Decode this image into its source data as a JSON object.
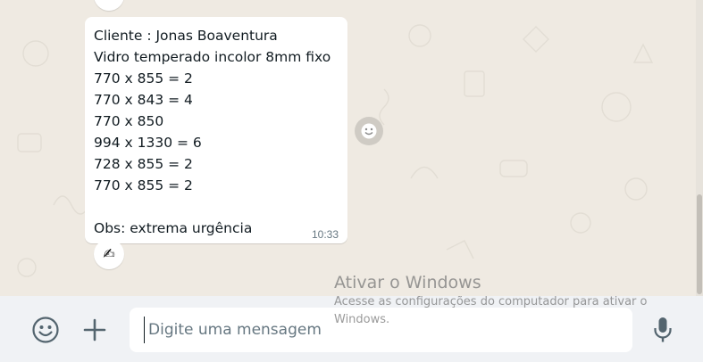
{
  "message": {
    "text": "Cliente : Jonas Boaventura\nVidro temperado incolor 8mm fixo\n770 x 855 = 2\n770 x 843 = 4\n770 x 850\n994 x 1330 = 6\n728 x 855 = 2\n770 x 855 = 2\n\nObs: extrema urgência",
    "time": "10:33"
  },
  "composer": {
    "placeholder": "Digite uma mensagem"
  },
  "watermark": {
    "title": "Ativar o Windows",
    "subtitle": "Acesse as configurações do computador para ativar o Windows."
  },
  "icons": {
    "sender_avatar": "hand-writing-icon",
    "reaction": "smiley-icon",
    "emoji": "emoji-icon",
    "attach": "plus-icon",
    "mic": "microphone-icon"
  },
  "colors": {
    "chat_background": "#efeae2",
    "bubble": "#ffffff",
    "footer": "#f0f2f5",
    "text": "#111b21",
    "muted": "#667781",
    "icon": "#54656f"
  }
}
